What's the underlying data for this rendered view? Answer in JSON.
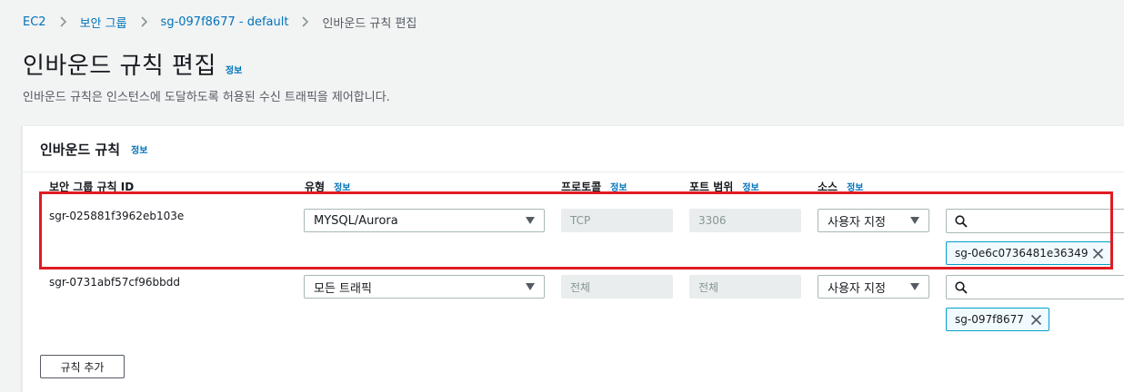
{
  "breadcrumb": {
    "items": [
      "EC2",
      "보안 그룹",
      "sg-097f8677 - default"
    ],
    "current": "인바운드 규칙 편집"
  },
  "page": {
    "title": "인바운드 규칙 편집",
    "info_label": "정보",
    "description": "인바운드 규칙은 인스턴스에 도달하도록 허용된 수신 트래픽을 제어합니다."
  },
  "panel": {
    "title": "인바운드 규칙",
    "info_label": "정보",
    "columns": [
      {
        "label": "보안 그룹 규칙 ID",
        "info": ""
      },
      {
        "label": "유형",
        "info": "정보"
      },
      {
        "label": "프로토콜",
        "info": "정보"
      },
      {
        "label": "포트 범위",
        "info": "정보"
      },
      {
        "label": "소스",
        "info": "정보"
      }
    ],
    "rules": [
      {
        "id": "sgr-025881f3962eb103e",
        "type": "MYSQL/Aurora",
        "protocol": "TCP",
        "port_range": "3306",
        "source_type": "사용자 지정",
        "source_search": "",
        "source_token": "sg-0e6c0736481e36349"
      },
      {
        "id": "sgr-0731abf57cf96bbdd",
        "type": "모든 트래픽",
        "protocol": "전체",
        "port_range": "전체",
        "source_type": "사용자 지정",
        "source_search": "",
        "source_token": "sg-097f8677"
      }
    ],
    "add_rule_label": "규칙 추가"
  },
  "icons": {
    "breadcrumb_separator": "chevron-right-icon",
    "dropdown": "caret-down-icon",
    "search": "search-icon",
    "remove_token": "close-icon"
  },
  "colors": {
    "link": "#0073bb",
    "highlight": "#e01b22",
    "token_border": "#00a1c9",
    "background": "#f2f3f3"
  }
}
